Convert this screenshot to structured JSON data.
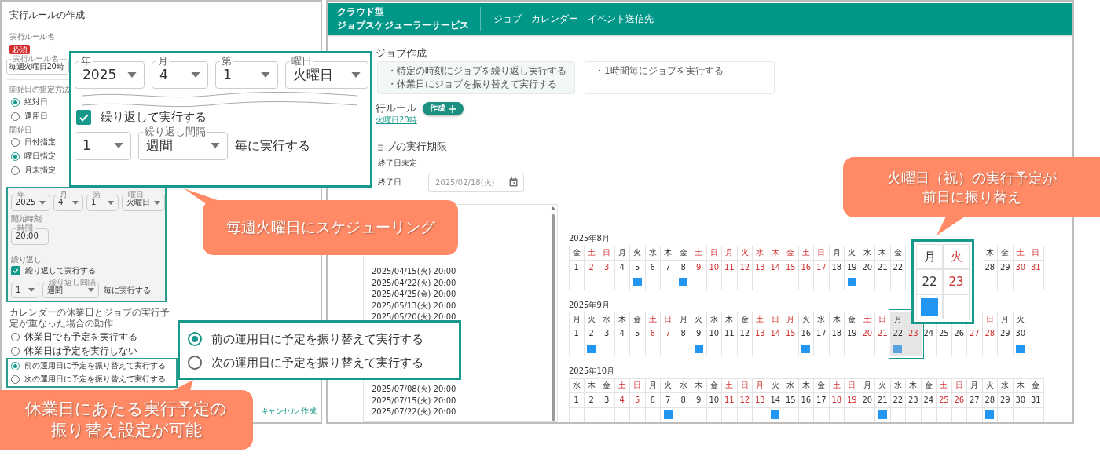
{
  "rule_dialog": {
    "title": "実行ルールの作成",
    "name_label": "実行ルール名",
    "required_badge": "必須",
    "name_field": {
      "label": "実行ルール名",
      "value": "毎週火曜日20時"
    },
    "start_method": {
      "label": "開始日の指定方法",
      "options": [
        {
          "label": "絶対日",
          "selected": true
        },
        {
          "label": "運用日",
          "selected": false
        }
      ]
    },
    "start_date": {
      "label": "開始日",
      "options": [
        {
          "label": "日付指定",
          "selected": false
        },
        {
          "label": "曜日指定",
          "selected": true
        },
        {
          "label": "月末指定",
          "selected": false
        }
      ]
    },
    "start_selects": [
      {
        "label": "年",
        "value": "2025"
      },
      {
        "label": "月",
        "value": "4"
      },
      {
        "label": "第",
        "value": "1"
      },
      {
        "label": "曜日",
        "value": "火曜日"
      }
    ],
    "start_time": {
      "label": "開始時刻",
      "field": {
        "label": "時間",
        "value": "20:00"
      }
    },
    "repeat": {
      "label": "繰り返し",
      "checkbox": {
        "label": "繰り返して実行する",
        "checked": true
      },
      "count": {
        "value": "1"
      },
      "interval": {
        "label": "繰り返し間隔",
        "value": "週間"
      },
      "suffix": "毎に実行する"
    },
    "holiday_behavior": {
      "label": "カレンダーの休業日とジョブの実行予定が重なった場合の動作",
      "options": [
        {
          "label": "休業日でも予定を実行する",
          "selected": false
        },
        {
          "label": "休業日は予定を実行しない",
          "selected": false
        },
        {
          "label": "前の運用日に予定を振り替えて実行する",
          "selected": true
        },
        {
          "label": "次の運用日に予定を振り替えて実行する",
          "selected": false
        }
      ]
    },
    "buttons": [
      {
        "label": "キャンセル"
      },
      {
        "label": "作成"
      }
    ]
  },
  "app": {
    "brand": [
      "クラウド型",
      "ジョブスケジューラーサービス"
    ],
    "nav": [
      "ジョブ",
      "カレンダー",
      "イベント送信先"
    ],
    "page_title": "ジョブ作成",
    "template_cards": [
      {
        "lines": [
          "・特定の時刻にジョブを繰り返し実行する",
          "・休業日にジョブを振り替えて実行する"
        ],
        "selected": true
      },
      {
        "lines": [
          "・1時間毎にジョブを実行する"
        ],
        "selected": false
      }
    ],
    "rule_section": {
      "title": "行ルール",
      "create_button": "作成",
      "rule_link": "火曜日20時"
    },
    "period_section": {
      "title": "ョブの実行期限",
      "options": [
        "終了日未定",
        "終了日"
      ],
      "end_date": {
        "placeholder": "2025/02/18(火)"
      }
    },
    "run_dates": [
      [
        "2025/04/15(火) 20:00",
        "2025/04/22(火) 20:00",
        "2025/04/25(金) 20:00",
        "2025/05/13(火) 20:00",
        "2025/05/20(火) 20:00"
      ],
      [
        "2025/07/08(火) 20:00",
        "2025/07/15(火) 20:00",
        "2025/07/22(火) 20:00"
      ]
    ],
    "calendar": [
      {
        "title": "2025年8月",
        "days": [
          {
            "weekday": "金",
            "date": "1",
            "holiday": false,
            "run": false
          },
          {
            "weekday": "土",
            "date": "2",
            "holiday": true,
            "run": false
          },
          {
            "weekday": "日",
            "date": "3",
            "holiday": true,
            "run": false
          },
          {
            "weekday": "月",
            "date": "4",
            "holiday": false,
            "run": false
          },
          {
            "weekday": "火",
            "date": "5",
            "holiday": false,
            "run": true
          },
          {
            "weekday": "水",
            "date": "6",
            "holiday": false,
            "run": false
          },
          {
            "weekday": "木",
            "date": "7",
            "holiday": false,
            "run": false
          },
          {
            "weekday": "金",
            "date": "8",
            "holiday": false,
            "run": true
          },
          {
            "weekday": "土",
            "date": "9",
            "holiday": true,
            "run": false
          },
          {
            "weekday": "日",
            "date": "10",
            "holiday": true,
            "run": false
          },
          {
            "weekday": "月",
            "date": "11",
            "holiday": true,
            "run": false
          },
          {
            "weekday": "火",
            "date": "12",
            "holiday": true,
            "run": false
          },
          {
            "weekday": "水",
            "date": "13",
            "holiday": true,
            "run": false
          },
          {
            "weekday": "木",
            "date": "14",
            "holiday": true,
            "run": false
          },
          {
            "weekday": "金",
            "date": "15",
            "holiday": true,
            "run": false
          },
          {
            "weekday": "土",
            "date": "16",
            "holiday": true,
            "run": false
          },
          {
            "weekday": "日",
            "date": "17",
            "holiday": true,
            "run": false
          },
          {
            "weekday": "月",
            "date": "18",
            "holiday": false,
            "run": false
          },
          {
            "weekday": "火",
            "date": "19",
            "holiday": false,
            "run": true
          },
          {
            "weekday": "水",
            "date": "20",
            "holiday": false,
            "run": false
          },
          {
            "weekday": "木",
            "date": "21",
            "holiday": false,
            "run": false
          },
          {
            "weekday": "金",
            "date": "22",
            "holiday": false,
            "run": false
          }
        ],
        "days_after_covered": [
          {
            "weekday": "木",
            "date": "28",
            "holiday": false,
            "run": false
          },
          {
            "weekday": "金",
            "date": "29",
            "holiday": false,
            "run": false
          },
          {
            "weekday": "土",
            "date": "30",
            "holiday": true,
            "run": false
          },
          {
            "weekday": "日",
            "date": "31",
            "holiday": true,
            "run": false
          }
        ]
      },
      {
        "title": "2025年9月",
        "days": [
          {
            "weekday": "月",
            "date": "1",
            "holiday": false,
            "run": false,
            "highlighted": false
          },
          {
            "weekday": "火",
            "date": "2",
            "holiday": false,
            "run": true,
            "highlighted": false
          },
          {
            "weekday": "水",
            "date": "3",
            "holiday": false,
            "run": false,
            "highlighted": false
          },
          {
            "weekday": "木",
            "date": "4",
            "holiday": false,
            "run": false,
            "highlighted": false
          },
          {
            "weekday": "金",
            "date": "5",
            "holiday": false,
            "run": false,
            "highlighted": false
          },
          {
            "weekday": "土",
            "date": "6",
            "holiday": true,
            "run": false,
            "highlighted": false
          },
          {
            "weekday": "日",
            "date": "7",
            "holiday": true,
            "run": false,
            "highlighted": false
          },
          {
            "weekday": "月",
            "date": "8",
            "holiday": false,
            "run": false,
            "highlighted": false
          },
          {
            "weekday": "火",
            "date": "9",
            "holiday": false,
            "run": true,
            "highlighted": false
          },
          {
            "weekday": "水",
            "date": "10",
            "holiday": false,
            "run": false,
            "highlighted": false
          },
          {
            "weekday": "木",
            "date": "11",
            "holiday": false,
            "run": false,
            "highlighted": false
          },
          {
            "weekday": "金",
            "date": "12",
            "holiday": false,
            "run": false,
            "highlighted": false
          },
          {
            "weekday": "土",
            "date": "13",
            "holiday": true,
            "run": false,
            "highlighted": false
          },
          {
            "weekday": "日",
            "date": "14",
            "holiday": true,
            "run": false,
            "highlighted": false
          },
          {
            "weekday": "月",
            "date": "15",
            "holiday": true,
            "run": false,
            "highlighted": false
          },
          {
            "weekday": "火",
            "date": "16",
            "holiday": false,
            "run": true,
            "highlighted": false
          },
          {
            "weekday": "水",
            "date": "17",
            "holiday": false,
            "run": false,
            "highlighted": false
          },
          {
            "weekday": "木",
            "date": "18",
            "holiday": false,
            "run": false,
            "highlighted": false
          },
          {
            "weekday": "金",
            "date": "19",
            "holiday": false,
            "run": false,
            "highlighted": false
          },
          {
            "weekday": "土",
            "date": "20",
            "holiday": true,
            "run": false,
            "highlighted": false
          },
          {
            "weekday": "日",
            "date": "21",
            "holiday": true,
            "run": false,
            "highlighted": false
          },
          {
            "weekday": "月",
            "date": "22",
            "holiday": false,
            "run": true,
            "highlighted": true
          },
          {
            "date": "23",
            "holiday": true,
            "run": false,
            "highlighted": true
          },
          {
            "date": "24",
            "holiday": false,
            "run": false,
            "highlighted": false
          },
          {
            "date": "25",
            "holiday": false,
            "run": false,
            "highlighted": false
          },
          {
            "date": "26",
            "holiday": false,
            "run": false,
            "highlighted": false
          },
          {
            "date": "27",
            "holiday": true,
            "run": false,
            "highlighted": false
          },
          {
            "weekday": "日",
            "date": "28",
            "holiday": true,
            "run": false,
            "highlighted": false
          },
          {
            "weekday": "月",
            "date": "29",
            "holiday": false,
            "run": false,
            "highlighted": false
          },
          {
            "weekday": "火",
            "date": "30",
            "holiday": false,
            "run": true,
            "highlighted": false
          }
        ]
      },
      {
        "title": "2025年10月",
        "days": [
          {
            "weekday": "水",
            "date": "1",
            "holiday": false,
            "run": false
          },
          {
            "weekday": "木",
            "date": "2",
            "holiday": false,
            "run": false
          },
          {
            "weekday": "金",
            "date": "3",
            "holiday": false,
            "run": false
          },
          {
            "weekday": "土",
            "date": "4",
            "holiday": true,
            "run": false
          },
          {
            "weekday": "日",
            "date": "5",
            "holiday": true,
            "run": false
          },
          {
            "weekday": "月",
            "date": "6",
            "holiday": false,
            "run": false
          },
          {
            "weekday": "火",
            "date": "7",
            "holiday": false,
            "run": true
          },
          {
            "weekday": "水",
            "date": "8",
            "holiday": false,
            "run": false
          },
          {
            "weekday": "木",
            "date": "9",
            "holiday": false,
            "run": false
          },
          {
            "weekday": "金",
            "date": "10",
            "holiday": false,
            "run": false
          },
          {
            "weekday": "土",
            "date": "11",
            "holiday": true,
            "run": false
          },
          {
            "weekday": "日",
            "date": "12",
            "holiday": true,
            "run": false
          },
          {
            "weekday": "月",
            "date": "13",
            "holiday": true,
            "run": false
          },
          {
            "weekday": "火",
            "date": "14",
            "holiday": false,
            "run": true
          },
          {
            "weekday": "水",
            "date": "15",
            "holiday": false,
            "run": false
          },
          {
            "weekday": "木",
            "date": "16",
            "holiday": false,
            "run": false
          },
          {
            "weekday": "金",
            "date": "17",
            "holiday": false,
            "run": false
          },
          {
            "weekday": "土",
            "date": "18",
            "holiday": true,
            "run": false
          },
          {
            "weekday": "日",
            "date": "19",
            "holiday": true,
            "run": false
          },
          {
            "weekday": "月",
            "date": "20",
            "holiday": false,
            "run": false
          },
          {
            "weekday": "火",
            "date": "21",
            "holiday": false,
            "run": true
          },
          {
            "weekday": "水",
            "date": "22",
            "holiday": false,
            "run": false
          },
          {
            "weekday": "木",
            "date": "23",
            "holiday": false,
            "run": false
          },
          {
            "weekday": "金",
            "date": "24",
            "holiday": false,
            "run": false
          },
          {
            "weekday": "土",
            "date": "25",
            "holiday": true,
            "run": false
          },
          {
            "weekday": "日",
            "date": "26",
            "holiday": true,
            "run": false
          },
          {
            "weekday": "月",
            "date": "27",
            "holiday": false,
            "run": false
          },
          {
            "weekday": "火",
            "date": "28",
            "holiday": false,
            "run": true
          },
          {
            "weekday": "水",
            "date": "29",
            "holiday": false,
            "run": false
          },
          {
            "weekday": "木",
            "date": "30",
            "holiday": false,
            "run": false
          },
          {
            "weekday": "金",
            "date": "31",
            "holiday": false,
            "run": false
          }
        ]
      }
    ]
  },
  "zoom_schedule": {
    "selects": [
      {
        "label": "年",
        "value": "2025"
      },
      {
        "label": "月",
        "value": "4"
      },
      {
        "label": "第",
        "value": "1"
      },
      {
        "label": "曜日",
        "value": "火曜日"
      }
    ],
    "checkbox": {
      "label": "繰り返して実行する",
      "checked": true
    },
    "count": {
      "value": "1"
    },
    "interval": {
      "label": "繰り返し間隔",
      "value": "週間"
    },
    "suffix": "毎に実行する"
  },
  "zoom_holiday": {
    "options": [
      {
        "label": "前の運用日に予定を振り替えて実行する",
        "selected": true
      },
      {
        "label": "次の運用日に予定を振り替えて実行する",
        "selected": false
      }
    ]
  },
  "zoom_shift": {
    "days": [
      {
        "weekday": "月",
        "date": "22",
        "holiday": false,
        "run": true
      },
      {
        "weekday": "火",
        "date": "23",
        "holiday": true,
        "run": false
      }
    ]
  },
  "callouts": [
    {
      "text": "毎週火曜日にスケジューリング"
    },
    {
      "text": "休業日にあたる実行予定の振り替え設定が可能"
    },
    {
      "text": "火曜日（祝）の実行予定が前日に振り替え"
    }
  ]
}
